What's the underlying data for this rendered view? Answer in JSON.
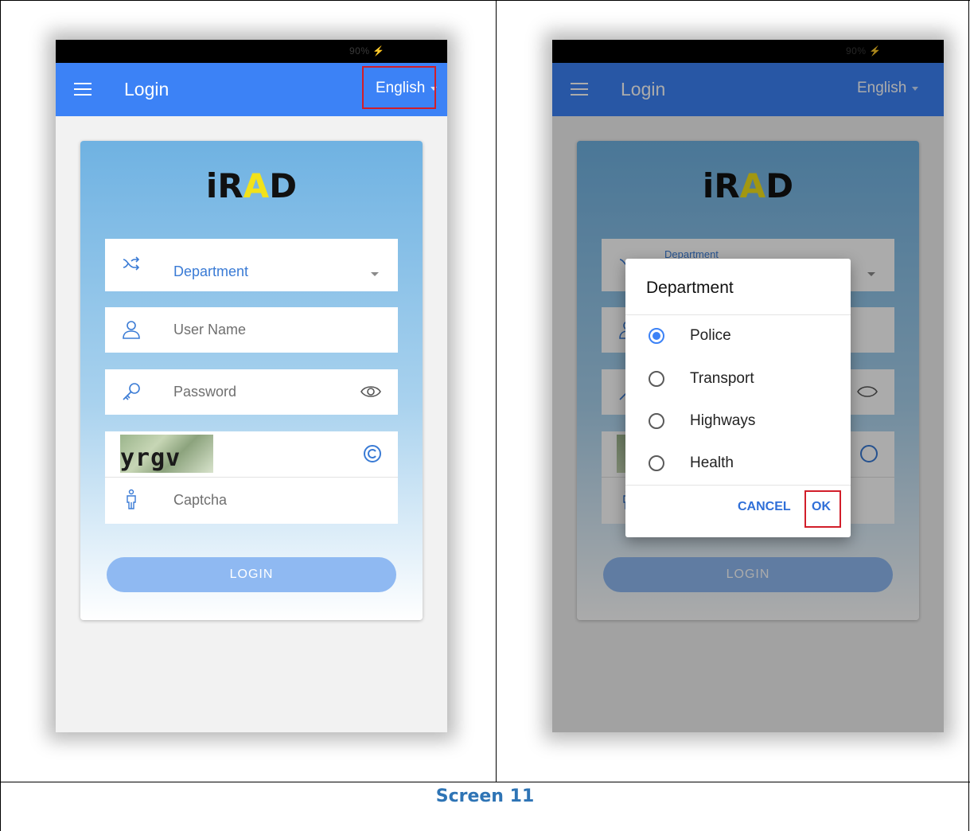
{
  "caption": "Screen 11",
  "status": {
    "text": "90% ⚡"
  },
  "appbar": {
    "title": "Login",
    "language": "English"
  },
  "logo": {
    "prefix": "iR",
    "accent": "A",
    "suffix": "D"
  },
  "form": {
    "department_placeholder": "Department",
    "department_floating_label": "Department",
    "username_placeholder": "User Name",
    "password_placeholder": "Password",
    "captcha_text": "yrgv",
    "captcha_placeholder": "Captcha",
    "login_label": "LOGIN"
  },
  "dialog": {
    "title": "Department",
    "options": [
      {
        "label": "Police",
        "selected": true
      },
      {
        "label": "Transport",
        "selected": false
      },
      {
        "label": "Highways",
        "selected": false
      },
      {
        "label": "Health",
        "selected": false
      }
    ],
    "cancel_label": "CANCEL",
    "ok_label": "OK"
  },
  "colors": {
    "appbar": "#3c82f6",
    "highlight": "#d21e2a",
    "caption": "#2E74B5"
  },
  "icons": [
    "menu-icon",
    "shuffle-icon",
    "user-icon",
    "key-icon",
    "eye-icon",
    "refresh-icon",
    "person-icon",
    "dropdown-caret-icon"
  ]
}
